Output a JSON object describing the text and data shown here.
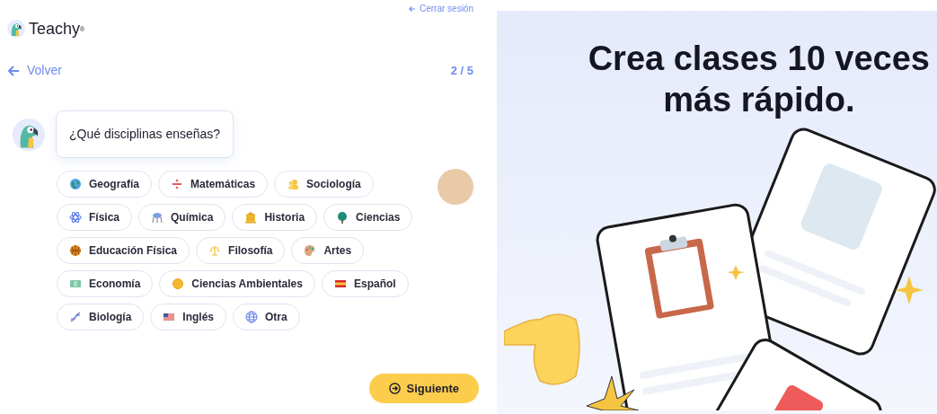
{
  "header": {
    "logout_link": "Cerrar sesión",
    "brand": "Teachy",
    "brand_mark": "®"
  },
  "nav": {
    "back": "Volver",
    "step": "2 / 5"
  },
  "question": "¿Qué disciplinas enseñas?",
  "subjects": [
    {
      "label": "Geografía",
      "selected": false
    },
    {
      "label": "Matemáticas",
      "selected": false
    },
    {
      "label": "Sociología",
      "selected": false
    },
    {
      "label": "Física",
      "selected": false
    },
    {
      "label": "Química",
      "selected": false
    },
    {
      "label": "Historia",
      "selected": false
    },
    {
      "label": "Ciencias",
      "selected": false
    },
    {
      "label": "Educación Física",
      "selected": false
    },
    {
      "label": "Filosofía",
      "selected": false
    },
    {
      "label": "Artes",
      "selected": false
    },
    {
      "label": "Economía",
      "selected": false
    },
    {
      "label": "Ciencias Ambientales",
      "selected": false
    },
    {
      "label": "Español",
      "selected": false
    },
    {
      "label": "Biología",
      "selected": false
    },
    {
      "label": "Inglés",
      "selected": false
    },
    {
      "label": "Otra",
      "selected": false
    }
  ],
  "next_button": "Siguiente",
  "promo": {
    "headline_line_1": "Crea clases 10 veces",
    "headline_line_2": "más rápido."
  }
}
